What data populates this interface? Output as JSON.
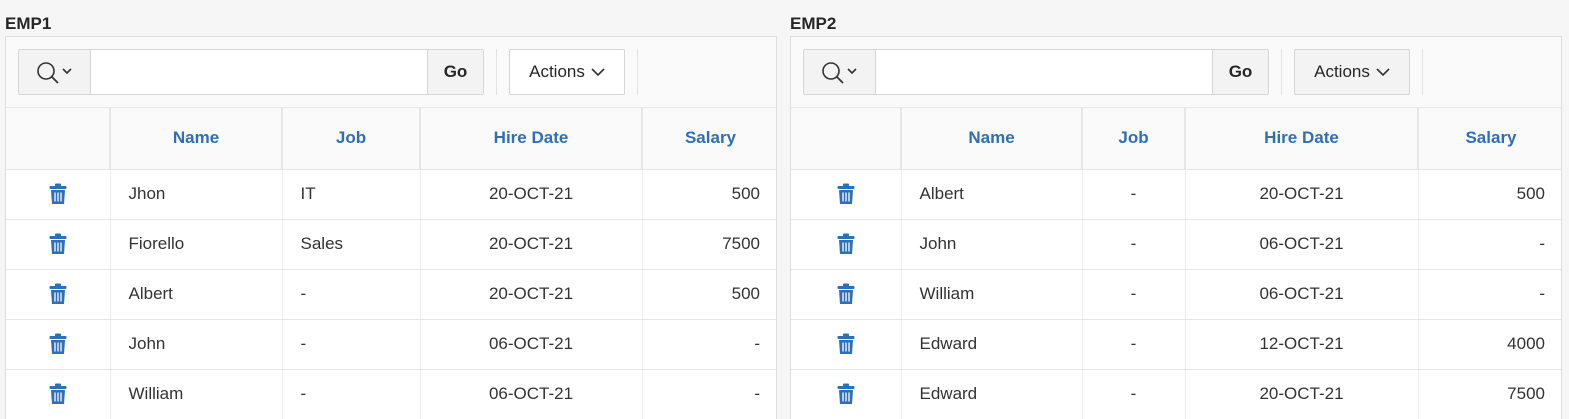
{
  "colors": {
    "header_link": "#2f6fb7",
    "icon": "#2f6fb7"
  },
  "regions": [
    {
      "title": "EMP1",
      "search": {
        "value": "",
        "go_label": "Go",
        "actions_label": "Actions"
      },
      "columns": [
        "Name",
        "Job",
        "Hire Date",
        "Salary"
      ],
      "rows": [
        {
          "name": "Jhon",
          "job": "IT",
          "hire_date": "20-OCT-21",
          "salary": "500"
        },
        {
          "name": "Fiorello",
          "job": "Sales",
          "hire_date": "20-OCT-21",
          "salary": "7500"
        },
        {
          "name": "Albert",
          "job": "-",
          "hire_date": "20-OCT-21",
          "salary": "500"
        },
        {
          "name": "John",
          "job": "-",
          "hire_date": "06-OCT-21",
          "salary": "-"
        },
        {
          "name": "William",
          "job": "-",
          "hire_date": "06-OCT-21",
          "salary": "-"
        }
      ]
    },
    {
      "title": "EMP2",
      "search": {
        "value": "",
        "go_label": "Go",
        "actions_label": "Actions"
      },
      "columns": [
        "Name",
        "Job",
        "Hire Date",
        "Salary"
      ],
      "rows": [
        {
          "name": "Albert",
          "job": "-",
          "hire_date": "20-OCT-21",
          "salary": "500"
        },
        {
          "name": "John",
          "job": "-",
          "hire_date": "06-OCT-21",
          "salary": "-"
        },
        {
          "name": "William",
          "job": "-",
          "hire_date": "06-OCT-21",
          "salary": "-"
        },
        {
          "name": "Edward",
          "job": "-",
          "hire_date": "12-OCT-21",
          "salary": "4000"
        },
        {
          "name": "Edward",
          "job": "-",
          "hire_date": "20-OCT-21",
          "salary": "7500"
        }
      ]
    }
  ]
}
